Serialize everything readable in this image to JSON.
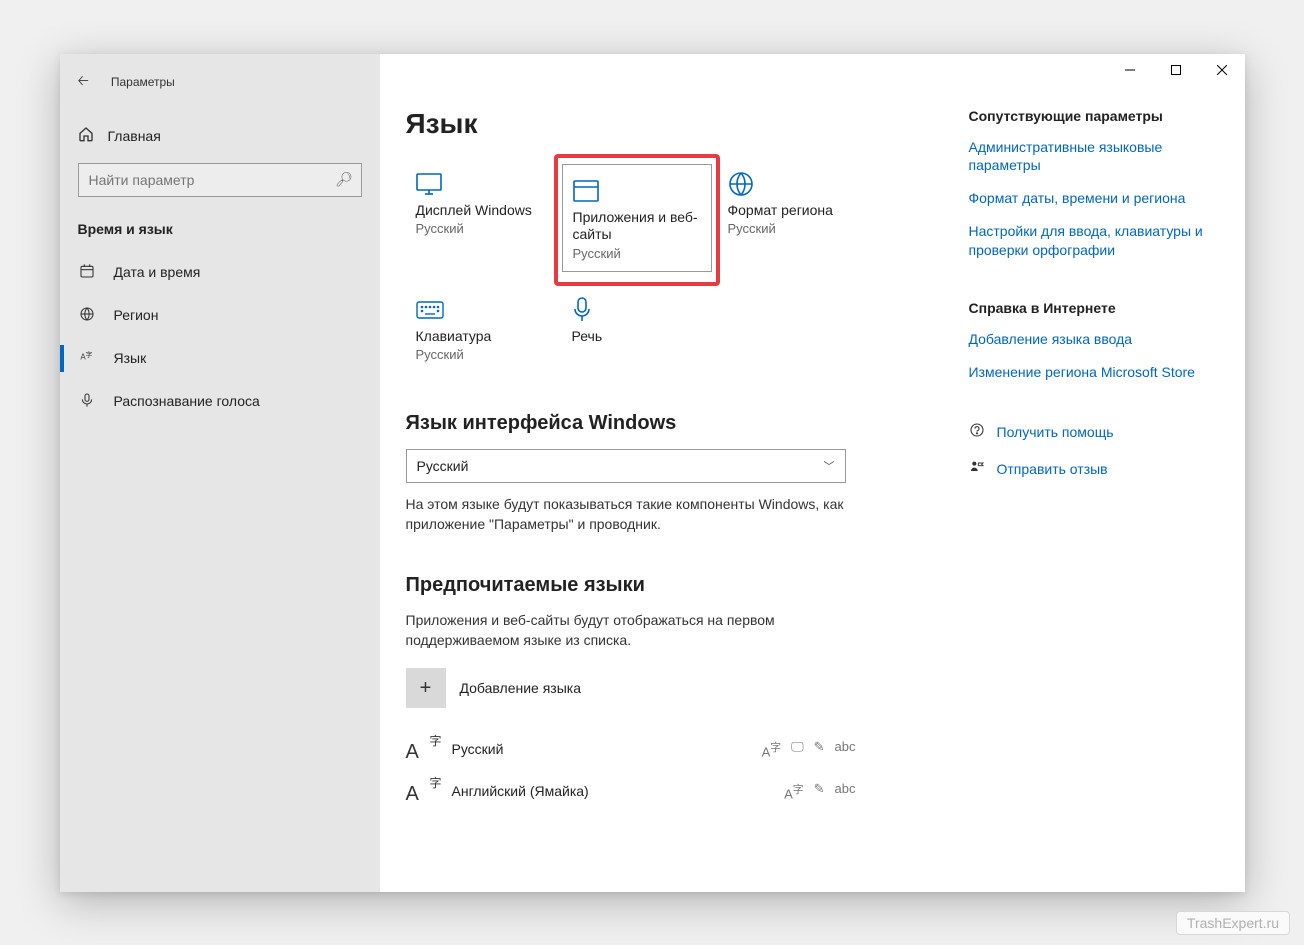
{
  "window": {
    "title": "Параметры"
  },
  "sidebar": {
    "home": "Главная",
    "search_placeholder": "Найти параметр",
    "section": "Время и язык",
    "items": [
      {
        "label": "Дата и время"
      },
      {
        "label": "Регион"
      },
      {
        "label": "Язык"
      },
      {
        "label": "Распознавание голоса"
      }
    ]
  },
  "page": {
    "title": "Язык",
    "tiles": [
      {
        "title": "Дисплей Windows",
        "sub": "Русский"
      },
      {
        "title": "Приложения и веб-сайты",
        "sub": "Русский"
      },
      {
        "title": "Формат региона",
        "sub": "Русский"
      },
      {
        "title": "Клавиатура",
        "sub": "Русский"
      },
      {
        "title": "Речь",
        "sub": ""
      }
    ],
    "display_lang": {
      "heading": "Язык интерфейса Windows",
      "value": "Русский",
      "desc": "На этом языке будут показываться такие компоненты Windows, как приложение \"Параметры\" и проводник."
    },
    "pref_lang": {
      "heading": "Предпочитаемые языки",
      "desc": "Приложения и веб-сайты будут отображаться на первом поддерживаемом языке из списка.",
      "add": "Добавление языка",
      "langs": [
        {
          "name": "Русский"
        },
        {
          "name": "Английский (Ямайка)"
        }
      ]
    }
  },
  "aside": {
    "related_h": "Сопутствующие параметры",
    "related_links": [
      "Административные языковые параметры",
      "Формат даты, времени и региона",
      "Настройки для ввода, клавиатуры и проверки орфографии"
    ],
    "help_h": "Справка в Интернете",
    "help_links": [
      "Добавление языка ввода",
      "Изменение региона Microsoft Store"
    ],
    "get_help": "Получить помощь",
    "feedback": "Отправить отзыв"
  },
  "watermark": "TrashExpert.ru"
}
